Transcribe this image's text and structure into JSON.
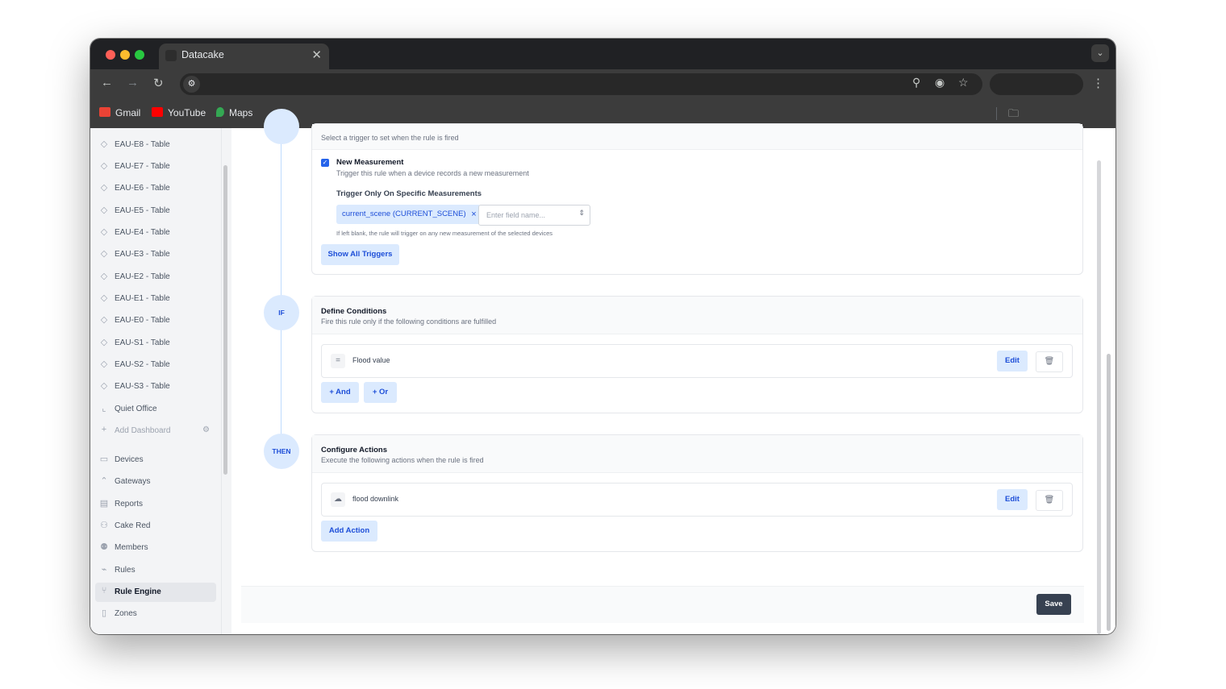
{
  "browser": {
    "tab_title": "Datacake",
    "tab_close": "✕",
    "tab_menu_icon": "⌄",
    "bookmarks": [
      {
        "label": "Gmail",
        "color": "#ea4335"
      },
      {
        "label": "YouTube",
        "color": "#ff0000"
      },
      {
        "label": "Maps",
        "color": "#34a853"
      }
    ]
  },
  "sidebar": {
    "items": [
      {
        "label": "EAU-E8 - Table",
        "icon": "droplet-icon"
      },
      {
        "label": "EAU-E7 - Table",
        "icon": "droplet-icon"
      },
      {
        "label": "EAU-E6 - Table",
        "icon": "droplet-icon"
      },
      {
        "label": "EAU-E5 - Table",
        "icon": "droplet-icon"
      },
      {
        "label": "EAU-E4 - Table",
        "icon": "droplet-icon"
      },
      {
        "label": "EAU-E3 - Table",
        "icon": "droplet-icon"
      },
      {
        "label": "EAU-E2 - Table",
        "icon": "droplet-icon"
      },
      {
        "label": "EAU-E1 - Table",
        "icon": "droplet-icon"
      },
      {
        "label": "EAU-E0 - Table",
        "icon": "droplet-icon"
      },
      {
        "label": "EAU-S1 - Table",
        "icon": "droplet-icon"
      },
      {
        "label": "EAU-S2 - Table",
        "icon": "droplet-icon"
      },
      {
        "label": "EAU-S3 - Table",
        "icon": "droplet-icon"
      },
      {
        "label": "Quiet Office",
        "icon": "chart-icon"
      },
      {
        "label": "Add Dashboard",
        "icon": "plus-icon"
      }
    ],
    "nav": [
      {
        "label": "Devices",
        "icon": "devices-icon"
      },
      {
        "label": "Gateways",
        "icon": "gateway-icon"
      },
      {
        "label": "Reports",
        "icon": "report-icon"
      },
      {
        "label": "Cake Red",
        "icon": "node-red-icon"
      },
      {
        "label": "Members",
        "icon": "members-icon"
      },
      {
        "label": "Rules",
        "icon": "rules-icon"
      },
      {
        "label": "Rule Engine",
        "icon": "branch-icon",
        "active": true
      },
      {
        "label": "Zones",
        "icon": "map-icon"
      }
    ],
    "active_color": "#e5e7eb"
  },
  "when": {
    "desc": "Select a trigger to set when the rule is fired",
    "trigger_label": "New Measurement",
    "trigger_desc": "Trigger this rule when a device records a new measurement",
    "specific_label": "Trigger Only On Specific Measurements",
    "chip": "current_scene (CURRENT_SCENE)",
    "field_placeholder": "Enter field name...",
    "hint": "If left blank, the rule will trigger on any new measurement of the selected devices",
    "show_all_button": "Show All Triggers"
  },
  "if": {
    "bubble": "IF",
    "title": "Define Conditions",
    "desc": "Fire this rule only if the following conditions are fulfilled",
    "condition_label": "Flood value",
    "edit_button": "Edit",
    "and_button": "+ And",
    "or_button": "+ Or"
  },
  "then": {
    "bubble": "THEN",
    "title": "Configure Actions",
    "desc": "Execute the following actions when the rule is fired",
    "action_label": "flood downlink",
    "edit_button": "Edit",
    "add_button": "Add Action"
  },
  "footer": {
    "save_button": "Save"
  },
  "colors": {
    "accent": "#2563eb",
    "accent_soft": "#dbeafe",
    "save_bg": "#374151"
  }
}
